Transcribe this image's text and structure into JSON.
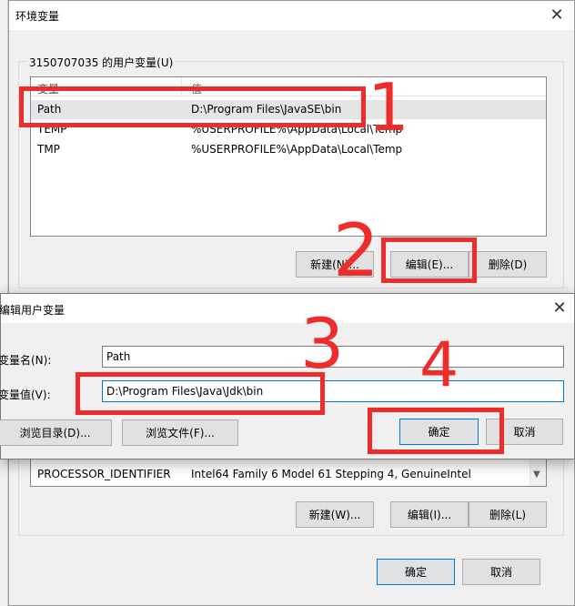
{
  "env_dialog": {
    "title": "环境变量",
    "user_section_label": "3150707035 的用户变量(U)",
    "columns": {
      "name": "变量",
      "value": "值"
    },
    "user_vars": [
      {
        "name": "Path",
        "value": "D:\\Program Files\\JavaSE\\bin"
      },
      {
        "name": "TEMP",
        "value": "%USERPROFILE%\\AppData\\Local\\Temp"
      },
      {
        "name": "TMP",
        "value": "%USERPROFILE%\\AppData\\Local\\Temp"
      }
    ],
    "user_buttons": {
      "new": "新建(N)...",
      "edit": "编辑(E)...",
      "delete": "删除(D)"
    },
    "system_vars_visible_row": {
      "name": "PROCESSOR_IDENTIFIER",
      "value": "Intel64 Family 6 Model 61 Stepping 4, GenuineIntel"
    },
    "system_buttons": {
      "new": "新建(W)...",
      "edit": "编辑(I)...",
      "delete": "删除(L)"
    },
    "footer_buttons": {
      "ok": "确定",
      "cancel": "取消"
    }
  },
  "edit_dialog": {
    "title": "编辑用户变量",
    "name_label": "变量名(N):",
    "name_value": "Path",
    "value_label": "变量值(V):",
    "value_value": "D:\\Program Files\\Java\\Jdk\\bin",
    "browse_dir": "浏览目录(D)...",
    "browse_file": "浏览文件(F)...",
    "ok": "确定",
    "cancel": "取消"
  },
  "annotations": {
    "n1": "1",
    "n2": "2",
    "n3": "3",
    "n4": "4"
  },
  "colors": {
    "annotation_red": "#ee2c2c",
    "selection": "#e5e5e5",
    "accent": "#0078d7"
  }
}
